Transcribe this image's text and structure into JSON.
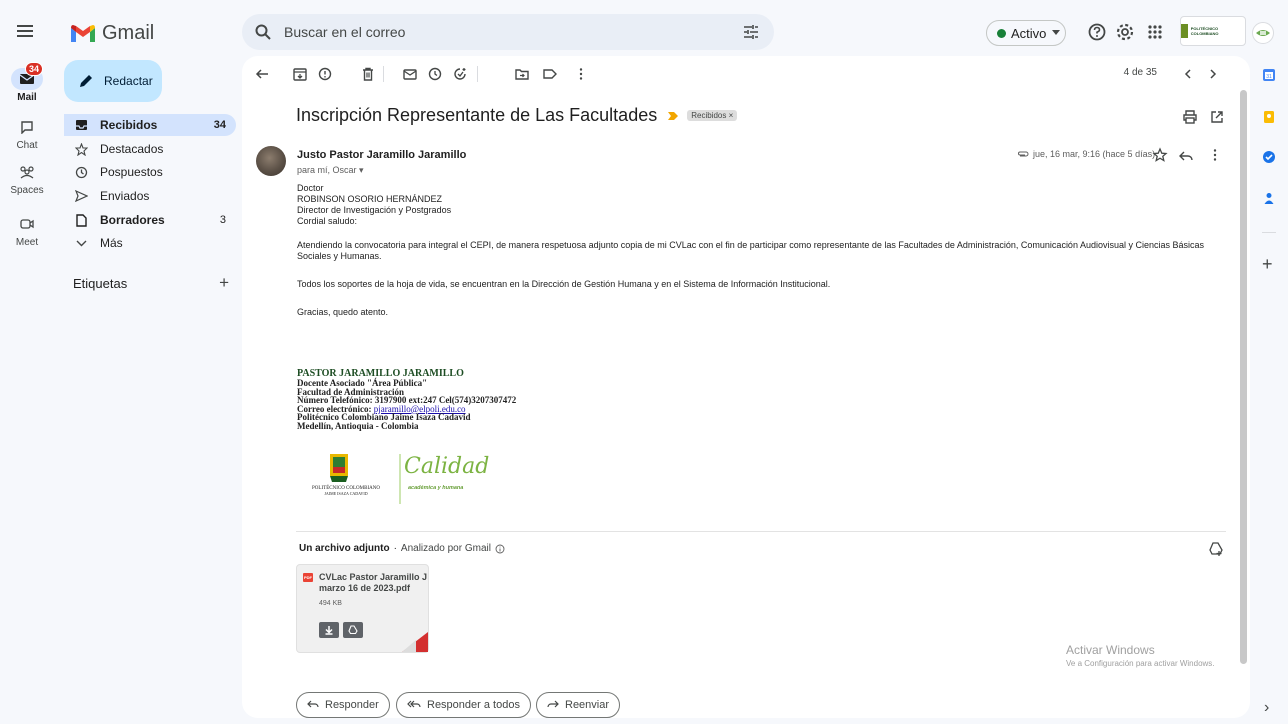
{
  "app": {
    "name": "Gmail"
  },
  "search": {
    "placeholder": "Buscar en el correo"
  },
  "status": {
    "label": "Activo"
  },
  "org_logo": {
    "text": "POLITÉCNICO COLOMBIANO"
  },
  "rail": [
    {
      "label": "Mail",
      "badge": "34",
      "icon": "mail-icon"
    },
    {
      "label": "Chat",
      "icon": "chat-icon"
    },
    {
      "label": "Spaces",
      "icon": "spaces-icon"
    },
    {
      "label": "Meet",
      "icon": "meet-icon"
    }
  ],
  "compose": {
    "label": "Redactar"
  },
  "nav": {
    "inbox": {
      "label": "Recibidos",
      "count": "34"
    },
    "starred": {
      "label": "Destacados"
    },
    "snoozed": {
      "label": "Pospuestos"
    },
    "sent": {
      "label": "Enviados"
    },
    "drafts": {
      "label": "Borradores",
      "count": "3"
    },
    "more": {
      "label": "Más"
    }
  },
  "labels": {
    "title": "Etiquetas",
    "add": "+"
  },
  "toolbar": {
    "page_info": "4 de 35"
  },
  "email": {
    "subject": "Inscripción Representante de Las Facultades",
    "tag": "Recibidos ×",
    "sender": "Justo Pastor Jaramillo Jaramillo",
    "to": "para mí, Oscar ▾",
    "date": "jue, 16 mar, 9:16 (hace 5 días)",
    "body": {
      "l1": "Doctor",
      "l2": "ROBINSON OSORIO HERNÁNDEZ",
      "l3": "Director de Investigación y Postgrados",
      "l4": "Cordial saludo:",
      "p1": "Atendiendo la convocatoria para integral el CEPI, de manera respetuosa adjunto copia de mi CVLac con el fin de participar como representante de las Facultades de Administración, Comunicación Audiovisual y Ciencias Básicas Sociales y Humanas.",
      "p2": "Todos los soportes de la hoja de vida, se encuentran en la Dirección de Gestión Humana y en el Sistema de Información Institucional.",
      "p3": "Gracias, quedo atento."
    },
    "signature": {
      "name": "PASTOR JARAMILLO JARAMILLO",
      "l1": "Docente Asociado \"Área Pública\"",
      "l2": "Facultad de Administración",
      "l3": "Número Telefónico: 3197900 ext:247  Cel(574)3207307472",
      "l4_prefix": "Correo electrónico: ",
      "l4_email": "pjaramillo@elpoli.edu.co",
      "l5": "Politécnico Colombiano Jaime Isaza Cadavid",
      "l6": "Medellín, Antioquia - Colombia",
      "logo_left": "POLITÉCNICO COLOMBIANO",
      "logo_left_sub": "JAIME ISAZA CADAVID",
      "logo_right": "Calidad",
      "logo_right_sub": "académica y humana"
    },
    "attachment_header": "Un archivo adjunto",
    "attachment_scan": "Analizado por Gmail",
    "attachment": {
      "type": "PDF",
      "name": "CVLac Pastor Jaramillo J marzo 16 de 2023.pdf",
      "size": "494 KB"
    }
  },
  "actions": {
    "reply": "Responder",
    "reply_all": "Responder a todos",
    "forward": "Reenviar"
  },
  "watermark": {
    "title": "Activar Windows",
    "subtitle": "Ve a Configuración para activar Windows."
  },
  "side_panel": {
    "add": "+",
    "expand": "›"
  }
}
